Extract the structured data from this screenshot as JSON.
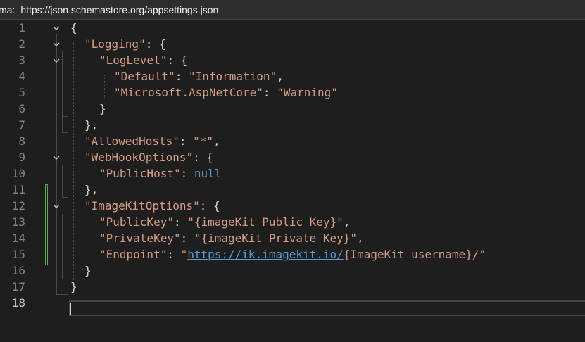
{
  "schema_bar": {
    "label": "ma:",
    "url": "https://json.schemastore.org/appsettings.json"
  },
  "lines": [
    {
      "n": "1"
    },
    {
      "n": "2"
    },
    {
      "n": "3"
    },
    {
      "n": "4"
    },
    {
      "n": "5"
    },
    {
      "n": "6"
    },
    {
      "n": "7"
    },
    {
      "n": "8"
    },
    {
      "n": "9"
    },
    {
      "n": "10"
    },
    {
      "n": "11"
    },
    {
      "n": "12"
    },
    {
      "n": "13"
    },
    {
      "n": "14"
    },
    {
      "n": "15"
    },
    {
      "n": "16"
    },
    {
      "n": "17"
    },
    {
      "n": "18"
    }
  ],
  "code": {
    "l1": "{",
    "l2_key": "\"Logging\"",
    "l3_key": "\"LogLevel\"",
    "l4_key": "\"Default\"",
    "l4_val": "\"Information\"",
    "l5_key": "\"Microsoft.AspNetCore\"",
    "l5_val": "\"Warning\"",
    "l8_key": "\"AllowedHosts\"",
    "l8_val": "\"*\"",
    "l9_key": "\"WebHookOptions\"",
    "l10_key": "\"PublicHost\"",
    "l10_val": "null",
    "l12_key": "\"ImageKitOptions\"",
    "l13_key": "\"PublicKey\"",
    "l13_val": "\"{imageKit Public Key}\"",
    "l14_key": "\"PrivateKey\"",
    "l14_val": "\"{imageKit Private Key}\"",
    "l15_key": "\"Endpoint\"",
    "l15_val_quote": "\"",
    "l15_val_link": "https://ik.imagekit.io/",
    "l15_val_rest": "{ImageKit username}/\""
  },
  "icons": {
    "fold": "chevron-down-icon"
  },
  "colors": {
    "background": "#1e1e1e",
    "string": "#d69d85",
    "keyword": "#569cd6",
    "line_number": "#858585",
    "change_marker": "#55a845"
  }
}
